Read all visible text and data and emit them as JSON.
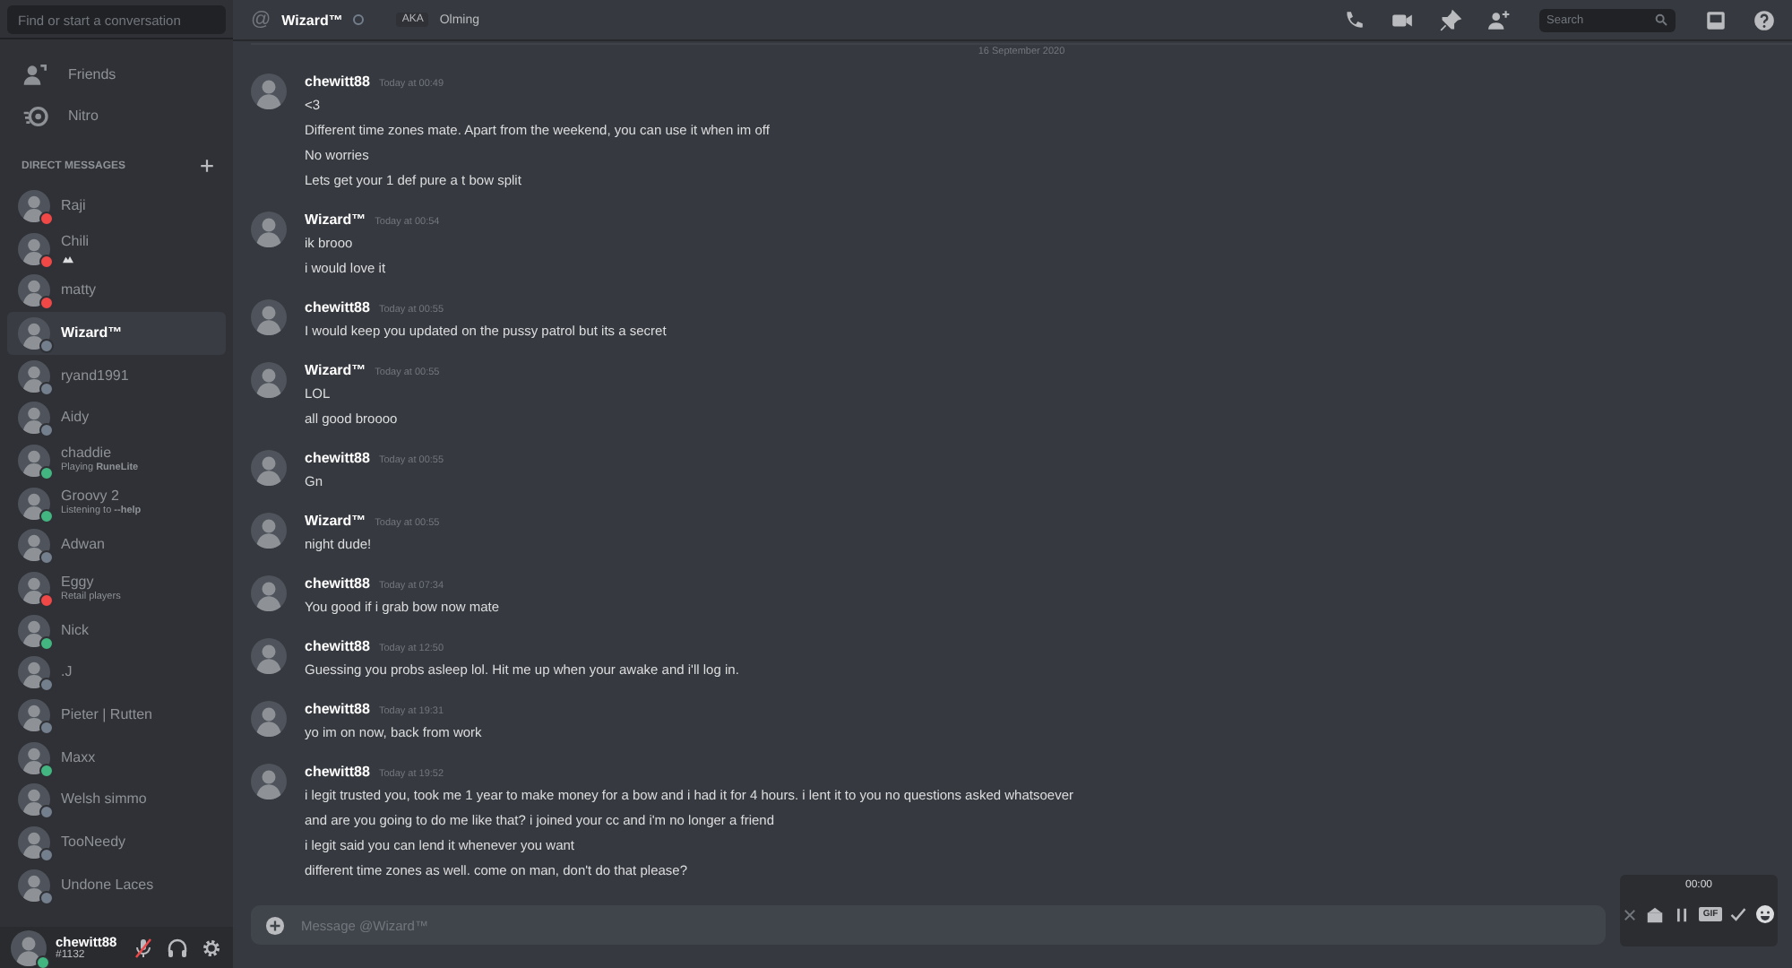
{
  "sidebar": {
    "search": {
      "placeholder": "Find or start a conversation"
    },
    "nav": [
      {
        "kind": "friends",
        "label": "Friends"
      },
      {
        "kind": "nitro",
        "label": "Nitro"
      }
    ],
    "section_title": "DIRECT MESSAGES",
    "direct_messages": [
      {
        "name": "Raji",
        "selected": false,
        "color": "#f04747"
      },
      {
        "name": "Chili",
        "selected": false,
        "color": "#f04747",
        "has_activity_icon": true
      },
      {
        "name": "matty",
        "selected": false,
        "color": "#f04747"
      },
      {
        "name": "Wizard™",
        "selected": true,
        "color": "#747f8d"
      },
      {
        "name": "ryand1991",
        "selected": false,
        "color": "#747f8d"
      },
      {
        "name": "Aidy",
        "selected": false,
        "color": "#747f8d"
      },
      {
        "name": "chaddie",
        "selected": false,
        "color": "#43b581",
        "activity": "Playing **RuneLite**"
      },
      {
        "name": "Groovy 2",
        "selected": false,
        "color": "#43b581",
        "activity": "Listening to **--help**"
      },
      {
        "name": "Adwan",
        "selected": false,
        "color": "#747f8d"
      },
      {
        "name": "Eggy",
        "selected": false,
        "color": "#f04747",
        "activity": "Retail players"
      },
      {
        "name": "Nick",
        "selected": false,
        "color": "#43b581"
      },
      {
        "name": ".J",
        "selected": false,
        "color": "#747f8d"
      },
      {
        "name": "Pieter | Rutten",
        "selected": false,
        "color": "#747f8d"
      },
      {
        "name": "Maxx",
        "selected": false,
        "color": "#43b581"
      },
      {
        "name": "Welsh simmo",
        "selected": false,
        "color": "#747f8d"
      },
      {
        "name": "TooNeedy",
        "selected": false,
        "color": "#747f8d"
      },
      {
        "name": "Undone Laces",
        "selected": false,
        "color": "#747f8d"
      }
    ],
    "user_panel": {
      "username": "chewitt88",
      "tag": "#1132",
      "color": "#43b581",
      "mic_muted": true
    }
  },
  "header": {
    "at": "@",
    "title": "Wizard™",
    "aka_label": "AKA",
    "aka_name": "Olming",
    "search": {
      "placeholder": "Search"
    }
  },
  "date_divider": "16 September 2020",
  "messages": [
    {
      "author": "chewitt88",
      "time": "Today at 00:49",
      "lines": [
        "<3",
        "Different time zones mate. Apart from the weekend, you can use it when im off",
        "No worries",
        "Lets get your 1 def pure a t bow split"
      ]
    },
    {
      "author": "Wizard™",
      "time": "Today at 00:54",
      "lines": [
        "ik brooo",
        "i would love it"
      ]
    },
    {
      "author": "chewitt88",
      "time": "Today at 00:55",
      "lines": [
        "I would keep you updated on the pussy patrol but its a secret"
      ]
    },
    {
      "author": "Wizard™",
      "time": "Today at 00:55",
      "lines": [
        "LOL",
        "all good broooo"
      ]
    },
    {
      "author": "chewitt88",
      "time": "Today at 00:55",
      "lines": [
        "Gn"
      ]
    },
    {
      "author": "Wizard™",
      "time": "Today at 00:55",
      "lines": [
        "night dude!"
      ]
    },
    {
      "author": "chewitt88",
      "time": "Today at 07:34",
      "lines": [
        "You good if i grab bow now mate"
      ]
    },
    {
      "author": "chewitt88",
      "time": "Today at 12:50",
      "lines": [
        "Guessing you probs asleep lol. Hit me up when your awake and i'll log in."
      ]
    },
    {
      "author": "chewitt88",
      "time": "Today at 19:31",
      "lines": [
        "yo im on now, back from work"
      ]
    },
    {
      "author": "chewitt88",
      "time": "Today at 19:52",
      "lines": [
        "i legit trusted you, took me 1 year to make money for a bow and i had it for 4 hours. i lent it to you no questions asked whatsoever",
        "and are you going to do me like that? i joined your cc and i'm no longer a friend",
        "i legit said you can lend it whenever you want",
        "different time zones as well. come on man, don't do that please?"
      ]
    }
  ],
  "composer": {
    "placeholder": "Message @Wizard™"
  },
  "recorder": {
    "time": "00:00",
    "gif_label": "GIF"
  }
}
